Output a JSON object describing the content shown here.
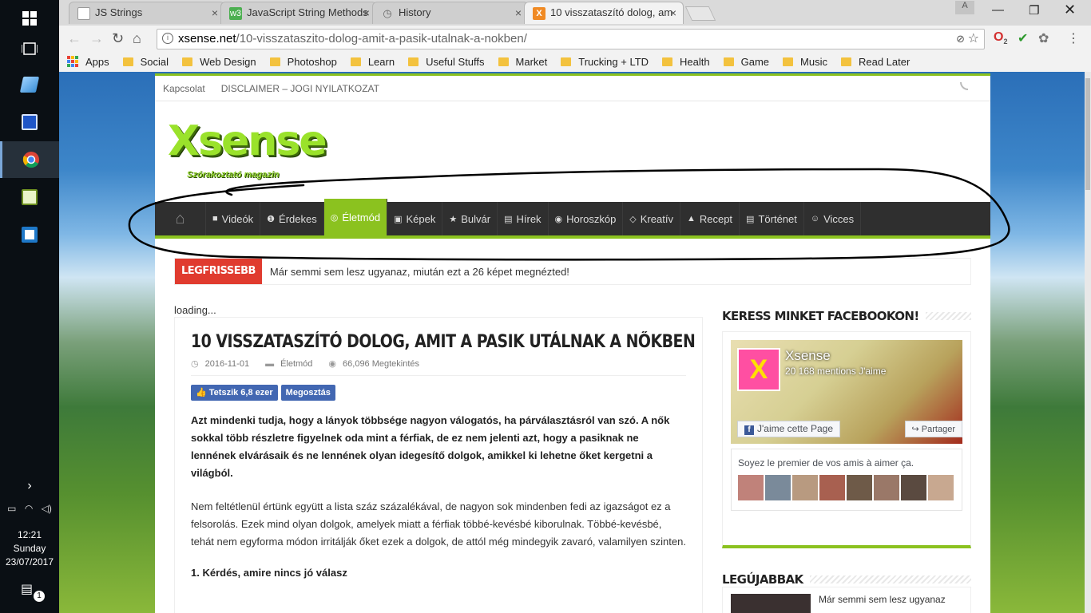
{
  "taskbar": {
    "clock_time": "12:21",
    "clock_day": "Sunday",
    "clock_date": "23/07/2017",
    "notification_count": "1"
  },
  "browser": {
    "tabs": [
      {
        "title": "JS Strings",
        "favicon": "page-icon"
      },
      {
        "title": "JavaScript String Methods",
        "favicon": "w3-icon"
      },
      {
        "title": "History",
        "favicon": "history-icon"
      },
      {
        "title": "10 visszataszító dolog, am",
        "favicon": "xsense-icon"
      }
    ],
    "profile_letter": "A",
    "url_host": "xsense.net",
    "url_path": "/10-visszataszito-dolog-amit-a-pasik-utalnak-a-nokben/",
    "ext_badge": "2",
    "bookmarks": [
      "Apps",
      "Social",
      "Web Design",
      "Photoshop",
      "Learn",
      "Useful Stuffs",
      "Market",
      "Trucking + LTD",
      "Health",
      "Game",
      "Music",
      "Read Later"
    ]
  },
  "site": {
    "topnav": [
      "Kapcsolat",
      "DISCLAIMER – JOGI NYILATKOZAT"
    ],
    "logo_text": "Xsense",
    "logo_tagline": "Szórakoztató magazin",
    "menu": [
      {
        "label": "Videók",
        "icon": "video-icon",
        "glyph": "■"
      },
      {
        "label": "Érdekes",
        "icon": "info-icon",
        "glyph": "❶"
      },
      {
        "label": "Életmód",
        "icon": "lifebuoy-icon",
        "glyph": "◎"
      },
      {
        "label": "Képek",
        "icon": "image-icon",
        "glyph": "▣"
      },
      {
        "label": "Bulvár",
        "icon": "star-icon",
        "glyph": "★"
      },
      {
        "label": "Hírek",
        "icon": "newspaper-icon",
        "glyph": "▤"
      },
      {
        "label": "Horoszkóp",
        "icon": "gamepad-icon",
        "glyph": "◉"
      },
      {
        "label": "Kreatív",
        "icon": "diamond-icon",
        "glyph": "◇"
      },
      {
        "label": "Recept",
        "icon": "flask-icon",
        "glyph": "▲"
      },
      {
        "label": "Történet",
        "icon": "list-icon",
        "glyph": "▤"
      },
      {
        "label": "Vicces",
        "icon": "smile-icon",
        "glyph": "☺"
      }
    ],
    "active_menu": "Életmód",
    "ticker_label": "LEGFRISSEBB",
    "ticker_text": "Már semmi sem lesz ugyanaz, miután ezt a 26 képet megnézted!",
    "loading": "loading...",
    "article": {
      "title": "10 VISSZATASZÍTÓ DOLOG, AMIT A PASIK UTÁLNAK A NŐKBEN",
      "date": "2016-11-01",
      "category": "Életmód",
      "views": "66,096 Megtekintés",
      "like_button": "Tetszik 6,8 ezer",
      "share_button": "Megosztás",
      "lead": "Azt mindenki tudja, hogy a lányok többsége nagyon válogatós, ha párválasztásról van szó. A nők sokkal több részletre figyelnek oda mint a férfiak, de ez nem jelenti azt, hogy a pasiknak ne lennének elvárásaik és ne lennének olyan idegesítő dolgok, amikkel ki lehetne őket kergetni a világból.",
      "paragraph": "Nem feltétlenül értünk együtt a lista száz százalékával, de nagyon sok mindenben fedi az igazságot ez a felsorolás. Ezek mind olyan dolgok, amelyek miatt a férfiak többé-kevésbé kiborulnak. Többé-kevésbé, tehát nem egyforma módon irritálják őket ezek a dolgok, de attól még mindegyik zavaró, valamilyen szinten.",
      "heading1": "1. Kérdés, amire nincs jó válasz"
    },
    "sidebar": {
      "fb_heading": "KERESS MINKET FACEBOOKON!",
      "fb_name": "Xsense",
      "fb_count": "20 168 mentions J'aime",
      "fb_like": "J'aime cette Page",
      "fb_share": "Partager",
      "fb_friends": "Soyez le premier de vos amis à aimer ça.",
      "newest_heading": "LEGÚJABBAK",
      "newest_item": "Már semmi sem lesz ugyanaz"
    }
  },
  "colors": {
    "accent_green": "#8bc21f",
    "nav_dark": "#2f2f2f",
    "ticker_red": "#e03b2f",
    "facebook_blue": "#4267b2"
  }
}
